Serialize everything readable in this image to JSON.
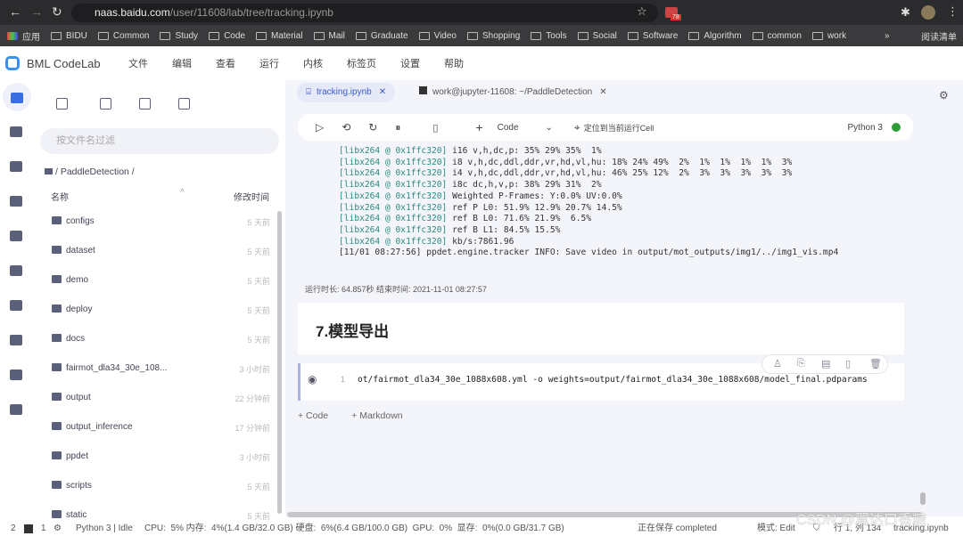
{
  "browser": {
    "url_host": "naas.baidu.com",
    "url_path": "/user/11608/lab/tree/tracking.ipynb",
    "badge": "78",
    "bookmarks": [
      "应用",
      "BIDU",
      "Common",
      "Study",
      "Code",
      "Material",
      "Mail",
      "Graduate",
      "Video",
      "Shopping",
      "Tools",
      "Social",
      "Software",
      "Algorithm",
      "common",
      "work"
    ],
    "more": "»",
    "reading_list": "阅读清单"
  },
  "app": {
    "name": "BML CodeLab",
    "menu": [
      "文件",
      "编辑",
      "查看",
      "运行",
      "内核",
      "标签页",
      "设置",
      "帮助"
    ]
  },
  "files": {
    "filter_placeholder": "按文件名过滤",
    "breadcrumb": "/ PaddleDetection /",
    "col_name": "名称",
    "col_time": "修改时间",
    "items": [
      {
        "name": "configs",
        "time": "5 天前"
      },
      {
        "name": "dataset",
        "time": "5 天前"
      },
      {
        "name": "demo",
        "time": "5 天前"
      },
      {
        "name": "deploy",
        "time": "5 天前"
      },
      {
        "name": "docs",
        "time": "5 天前"
      },
      {
        "name": "fairmot_dla34_30e_108...",
        "time": "3 小时前"
      },
      {
        "name": "output",
        "time": "22 分钟前"
      },
      {
        "name": "output_inference",
        "time": "17 分钟前"
      },
      {
        "name": "ppdet",
        "time": "3 小时前"
      },
      {
        "name": "scripts",
        "time": "5 天前"
      },
      {
        "name": "static",
        "time": "5 天前"
      }
    ]
  },
  "tabs": [
    {
      "label": "tracking.ipynb",
      "active": true
    },
    {
      "label": "work@jupyter-11608: ~/PaddleDetection",
      "active": false
    }
  ],
  "toolbar": {
    "cell_type": "Code",
    "locate": "定位到当前运行Cell",
    "kernel": "Python 3",
    "kernel_status_color": "#2e9b3a"
  },
  "output": [
    {
      "p": "[libx264 @ 0x1ffc320]",
      "t": " i16 v,h,dc,p: 35% 29% 35%  1%"
    },
    {
      "p": "[libx264 @ 0x1ffc320]",
      "t": " i8 v,h,dc,ddl,ddr,vr,hd,vl,hu: 18% 24% 49%  2%  1%  1%  1%  1%  3%"
    },
    {
      "p": "[libx264 @ 0x1ffc320]",
      "t": " i4 v,h,dc,ddl,ddr,vr,hd,vl,hu: 46% 25% 12%  2%  3%  3%  3%  3%  3%"
    },
    {
      "p": "[libx264 @ 0x1ffc320]",
      "t": " i8c dc,h,v,p: 38% 29% 31%  2%"
    },
    {
      "p": "[libx264 @ 0x1ffc320]",
      "t": " Weighted P-Frames: Y:0.0% UV:0.0%"
    },
    {
      "p": "[libx264 @ 0x1ffc320]",
      "t": " ref P L0: 51.9% 12.9% 20.7% 14.5%"
    },
    {
      "p": "[libx264 @ 0x1ffc320]",
      "t": " ref B L0: 71.6% 21.9%  6.5%"
    },
    {
      "p": "[libx264 @ 0x1ffc320]",
      "t": " ref B L1: 84.5% 15.5%"
    },
    {
      "p": "[libx264 @ 0x1ffc320]",
      "t": " kb/s:7861.96"
    },
    {
      "p": "",
      "t": "[11/01 08:27:56] ppdet.engine.tracker INFO: Save video in output/mot_outputs/img1/../img1_vis.mp4"
    }
  ],
  "runinfo": "运行时长: 64.857秒    结束时间: 2021-11-01 08:27:57",
  "heading": "7.模型导出",
  "cell": {
    "line": "1",
    "code": "ot/fairmot_dla34_30e_1088x608.yml -o weights=output/fairmot_dla34_30e_1088x608/model_final.pdparams"
  },
  "add": {
    "code": "+ Code",
    "markdown": "+ Markdown"
  },
  "status": {
    "n1": "2",
    "n2": "1",
    "kernel": "Python 3 | Idle",
    "resources": "CPU:  5% 内存:  4%(1.4 GB/32.0 GB) 硬盘:  6%(6.4 GB/100.0 GB)  GPU:  0%  显存:  0%(0.0 GB/31.7 GB)",
    "saving": "正在保存 completed",
    "mode": "模式: Edit",
    "pos": "行 1, 列 134",
    "file": "tracking.ipynb"
  },
  "watermark": "CSDN @翼达口香糖"
}
